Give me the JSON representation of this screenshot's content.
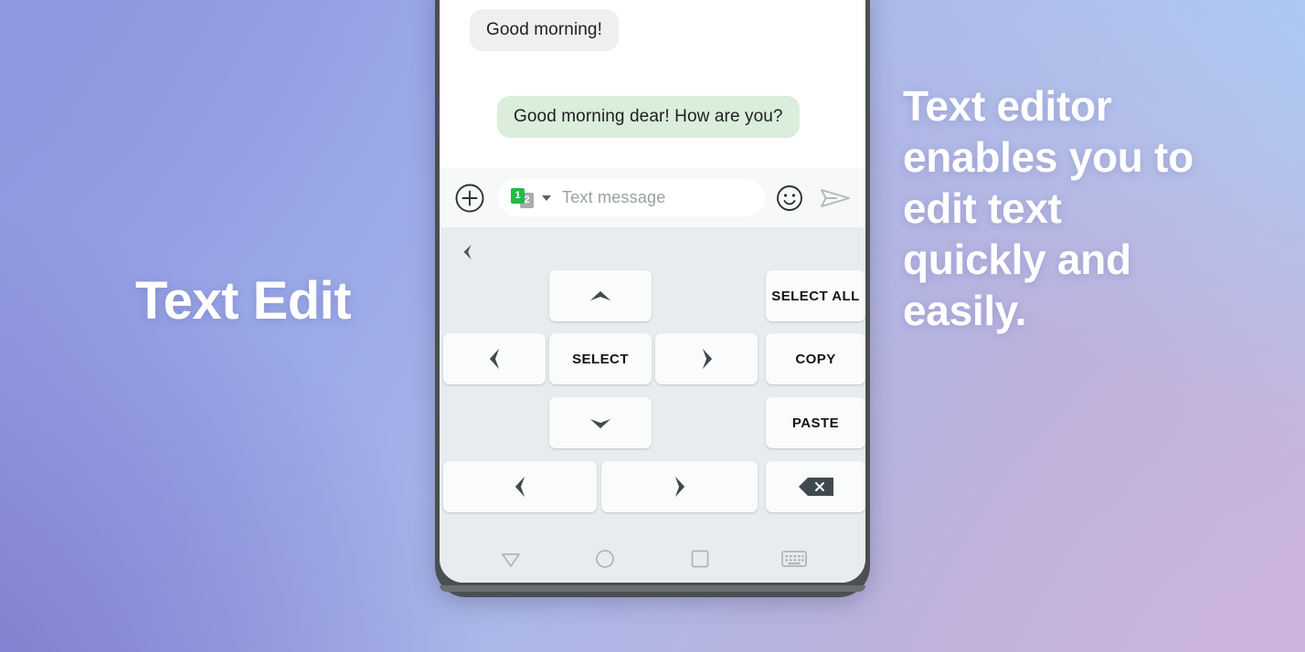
{
  "overlay": {
    "headline_left": "Text Edit",
    "headline_right": "Text editor enables you to edit text quickly and easily."
  },
  "conversation": {
    "messages": [
      {
        "text": "Good morning!",
        "side": "incoming"
      },
      {
        "text": "Good morning dear! How are you?",
        "side": "outgoing"
      }
    ]
  },
  "compose": {
    "add_icon": "plus-circle-icon",
    "sim_selector": {
      "sim1": "1",
      "sim2": "2",
      "caret_icon": "caret-down-icon"
    },
    "placeholder": "Text message",
    "value": "",
    "emoji_icon": "smiley-face-icon",
    "send_icon": "send-paper-plane-icon"
  },
  "keyboard": {
    "collapse_icon": "chevron-left-icon",
    "rows": [
      {
        "keys": [
          {
            "label": "",
            "icon": "chevron-up-icon",
            "name": "key-cursor-up"
          },
          {
            "label": "SELECT ALL",
            "icon": "",
            "name": "key-select-all"
          }
        ]
      },
      {
        "keys": [
          {
            "label": "",
            "icon": "chevron-left-icon",
            "name": "key-cursor-left"
          },
          {
            "label": "SELECT",
            "icon": "",
            "name": "key-select"
          },
          {
            "label": "",
            "icon": "chevron-right-icon",
            "name": "key-cursor-right"
          },
          {
            "label": "COPY",
            "icon": "",
            "name": "key-copy"
          }
        ]
      },
      {
        "keys": [
          {
            "label": "",
            "icon": "chevron-down-icon",
            "name": "key-cursor-down"
          },
          {
            "label": "PASTE",
            "icon": "",
            "name": "key-paste"
          }
        ]
      },
      {
        "keys": [
          {
            "label": "",
            "icon": "chevron-left-icon",
            "name": "key-word-left"
          },
          {
            "label": "",
            "icon": "chevron-right-icon",
            "name": "key-word-right"
          },
          {
            "label": "",
            "icon": "backspace-icon",
            "name": "key-backspace"
          }
        ]
      }
    ]
  },
  "navbar": {
    "back_icon": "triangle-down-back-icon",
    "home_icon": "circle-home-icon",
    "recents_icon": "square-recents-icon",
    "keyboard_icon": "keyboard-toggle-icon"
  },
  "colors": {
    "accent_green": "#22bb44",
    "bubble_incoming": "#efefef",
    "bubble_outgoing": "#daeedb",
    "keyboard_bg": "#e8ecee",
    "key_bg": "#fafbfb",
    "glyph_dark": "#3f4a4f"
  }
}
